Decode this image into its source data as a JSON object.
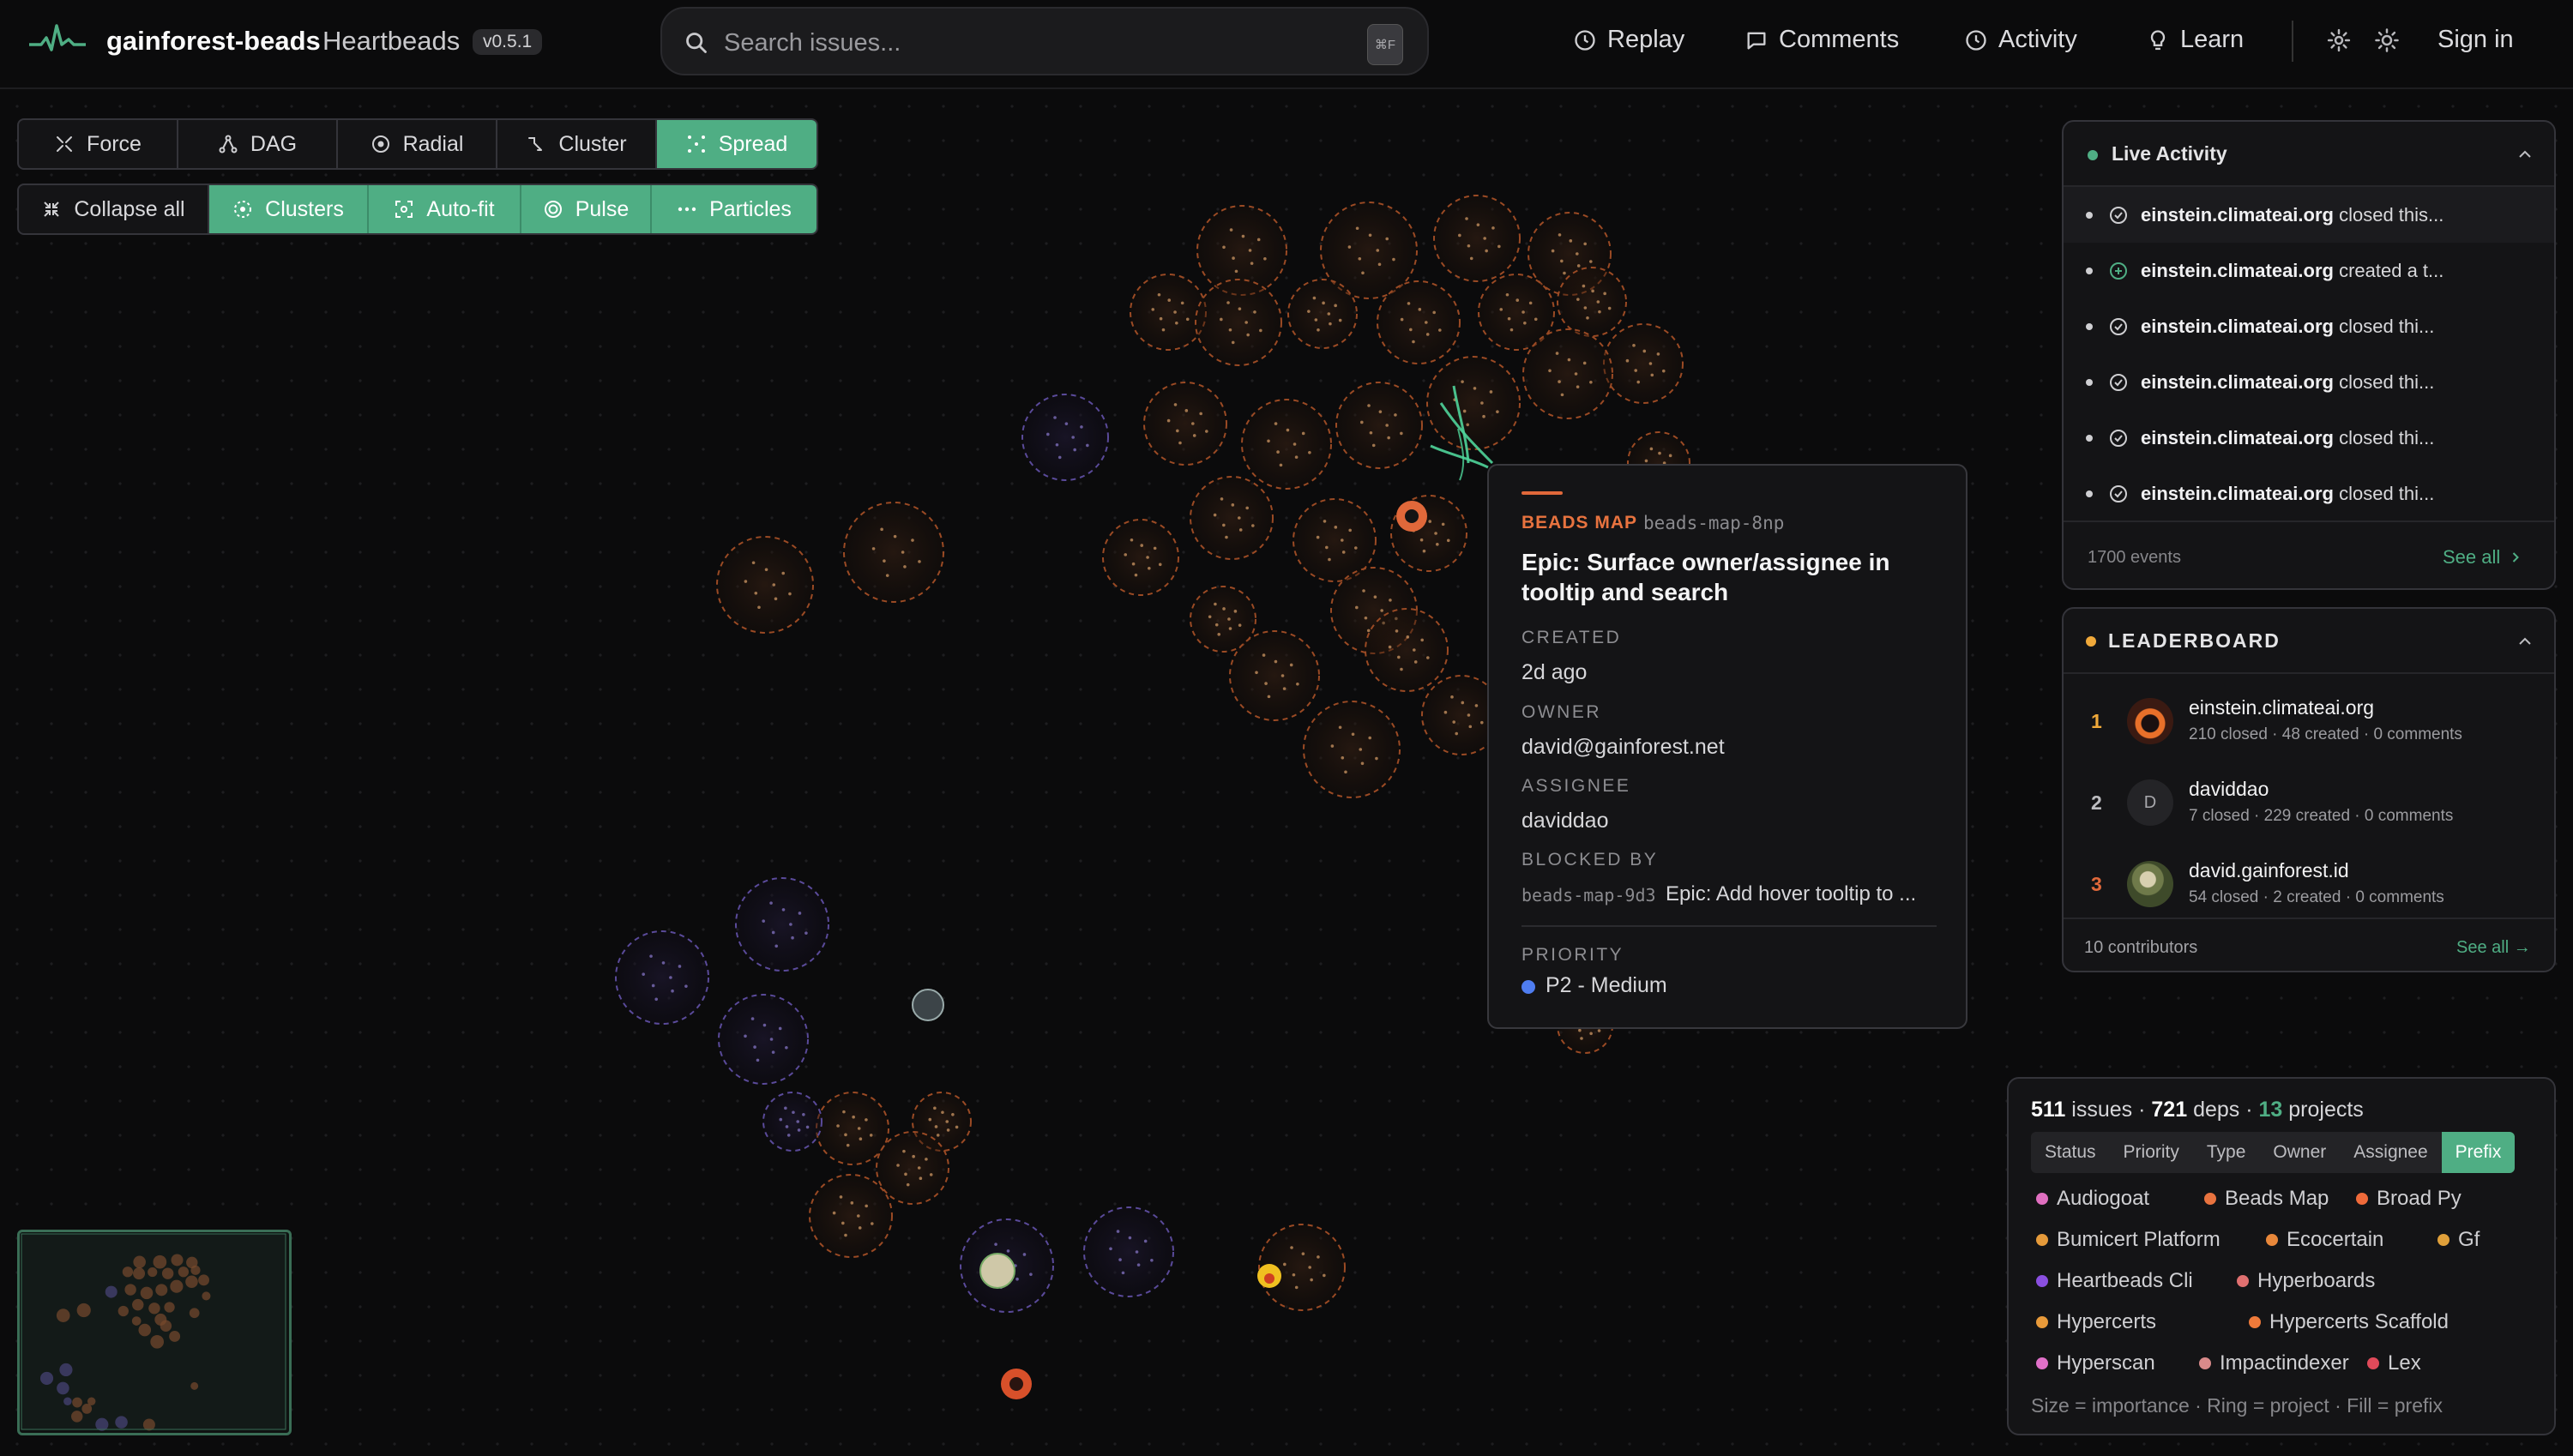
{
  "app": {
    "name": "gainforest-beads",
    "subtitle": "Heartbeads",
    "version": "v0.5.1",
    "brand_color": "#4fae84"
  },
  "search": {
    "placeholder": "Search issues...",
    "shortcut": "⌘F"
  },
  "nav": {
    "replay": "Replay",
    "comments": "Comments",
    "activity": "Activity",
    "learn": "Learn",
    "sign_in": "Sign in"
  },
  "layout_modes": {
    "force": "Force",
    "dag": "DAG",
    "radial": "Radial",
    "cluster": "Cluster",
    "spread": "Spread",
    "active": "Spread"
  },
  "view_toggles": {
    "collapse_all": "Collapse all",
    "clusters": "Clusters",
    "auto_fit": "Auto-fit",
    "pulse": "Pulse",
    "particles": "Particles"
  },
  "tooltip": {
    "project": "BEADS MAP",
    "issue_id": "beads-map-8np",
    "title": "Epic: Surface owner/assignee in tooltip and search",
    "created_label": "CREATED",
    "created": "2d ago",
    "owner_label": "OWNER",
    "owner": "david@gainforest.net",
    "assignee_label": "ASSIGNEE",
    "assignee": "daviddao",
    "blocked_by_label": "BLOCKED BY",
    "blocked_by_id": "beads-map-9d3",
    "blocked_by_title": "Epic: Add hover tooltip to ...",
    "priority_label": "PRIORITY",
    "priority": "P2 - Medium"
  },
  "live_activity": {
    "title": "Live Activity",
    "events": [
      {
        "user": "einstein.climateai.org",
        "action": "closed this...",
        "icon": "check-circle-icon"
      },
      {
        "user": "einstein.climateai.org",
        "action": "created a t...",
        "icon": "plus-circle-icon"
      },
      {
        "user": "einstein.climateai.org",
        "action": "closed thi...",
        "icon": "check-circle-icon"
      },
      {
        "user": "einstein.climateai.org",
        "action": "closed thi...",
        "icon": "check-circle-icon"
      },
      {
        "user": "einstein.climateai.org",
        "action": "closed thi...",
        "icon": "check-circle-icon"
      },
      {
        "user": "einstein.climateai.org",
        "action": "closed thi...",
        "icon": "check-circle-icon"
      }
    ],
    "count": "1700 events",
    "see_all": "See all"
  },
  "leaderboard": {
    "title": "LEADERBOARD",
    "entries": [
      {
        "rank": "1",
        "name": "einstein.climateai.org",
        "stats": "210 closed · 48 created · 0 comments"
      },
      {
        "rank": "2",
        "name": "daviddao",
        "initial": "D",
        "stats": "7 closed · 229 created · 0 comments"
      },
      {
        "rank": "3",
        "name": "david.gainforest.id",
        "stats": "54 closed · 2 created · 0 comments"
      }
    ],
    "contributors": "10 contributors",
    "see_all": "See all →"
  },
  "stats": {
    "issues": "511",
    "issues_label": "issues",
    "deps": "721",
    "deps_label": "deps",
    "projects": "13",
    "projects_label": "projects",
    "color_by": [
      "Status",
      "Priority",
      "Type",
      "Owner",
      "Assignee",
      "Prefix"
    ],
    "color_by_active": "Prefix",
    "legend": [
      {
        "label": "Audiogoat",
        "color": "#e06fc0"
      },
      {
        "label": "Beads Map",
        "color": "#e8733f"
      },
      {
        "label": "Broad Py",
        "color": "#ef6a3a"
      },
      {
        "label": "Bumicert Platform",
        "color": "#e59a3a"
      },
      {
        "label": "Ecocertain",
        "color": "#e8873a"
      },
      {
        "label": "Gf",
        "color": "#e0a03a"
      },
      {
        "label": "Heartbeads Cli",
        "color": "#8a4fe0"
      },
      {
        "label": "Hyperboards",
        "color": "#e07070"
      },
      {
        "label": "Hypercerts",
        "color": "#e89a3a"
      },
      {
        "label": "Hypercerts Scaffold",
        "color": "#ef7a3a"
      },
      {
        "label": "Hyperscan",
        "color": "#e070c8"
      },
      {
        "label": "Impactindexer",
        "color": "#d98a8a"
      },
      {
        "label": "Lex",
        "color": "#e04a5a"
      }
    ],
    "footnote": "Size = importance · Ring = project · Fill = prefix"
  }
}
